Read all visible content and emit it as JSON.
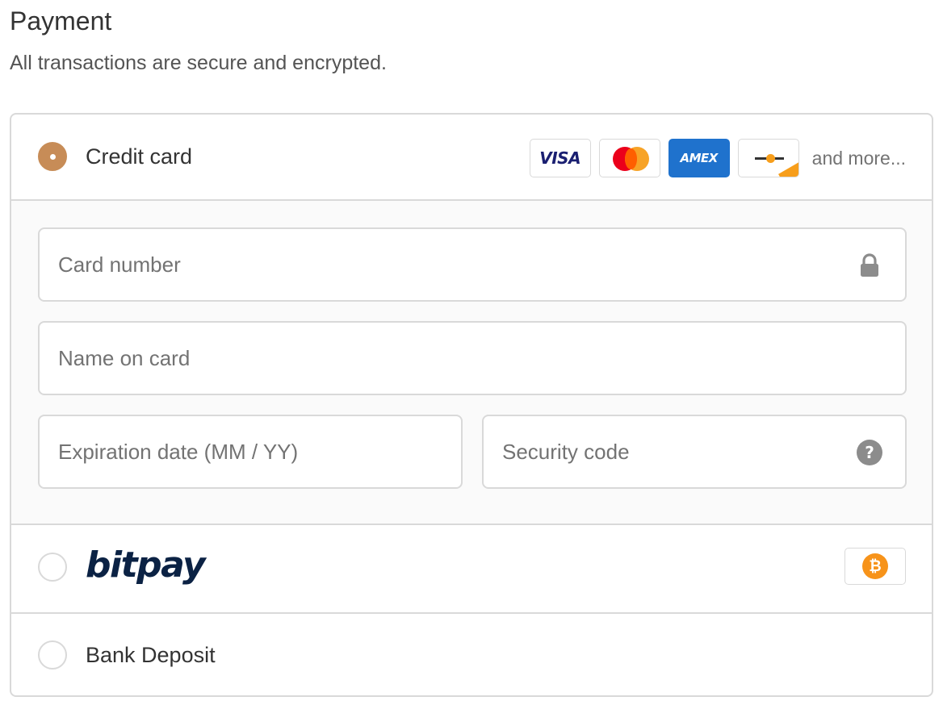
{
  "header": {
    "title": "Payment",
    "subtitle": "All transactions are secure and encrypted."
  },
  "colors": {
    "accent": "#c78c57",
    "border": "#d9d9d9",
    "form_bg": "#fafafa",
    "bitpay_navy": "#0b2244",
    "bitcoin_orange": "#f7931a",
    "amex_blue": "#1f72cd"
  },
  "payment_methods": [
    {
      "id": "credit_card",
      "label": "Credit card",
      "selected": true,
      "badges": [
        {
          "name": "visa",
          "text": "VISA"
        },
        {
          "name": "mastercard",
          "text": ""
        },
        {
          "name": "amex",
          "text": "AMEX"
        },
        {
          "name": "generic-card",
          "text": ""
        }
      ],
      "badges_more": "and more..."
    },
    {
      "id": "bitpay",
      "label": "bitpay",
      "selected": false,
      "badge_icon": "bitcoin-icon",
      "badge_text": "₿"
    },
    {
      "id": "bank_deposit",
      "label": "Bank Deposit",
      "selected": false
    }
  ],
  "card_form": {
    "card_number": {
      "placeholder": "Card number",
      "value": "",
      "icon": "lock-icon"
    },
    "name_on_card": {
      "placeholder": "Name on card",
      "value": ""
    },
    "expiration": {
      "placeholder": "Expiration date (MM / YY)",
      "value": ""
    },
    "security_code": {
      "placeholder": "Security code",
      "value": "",
      "icon": "help-icon"
    }
  }
}
